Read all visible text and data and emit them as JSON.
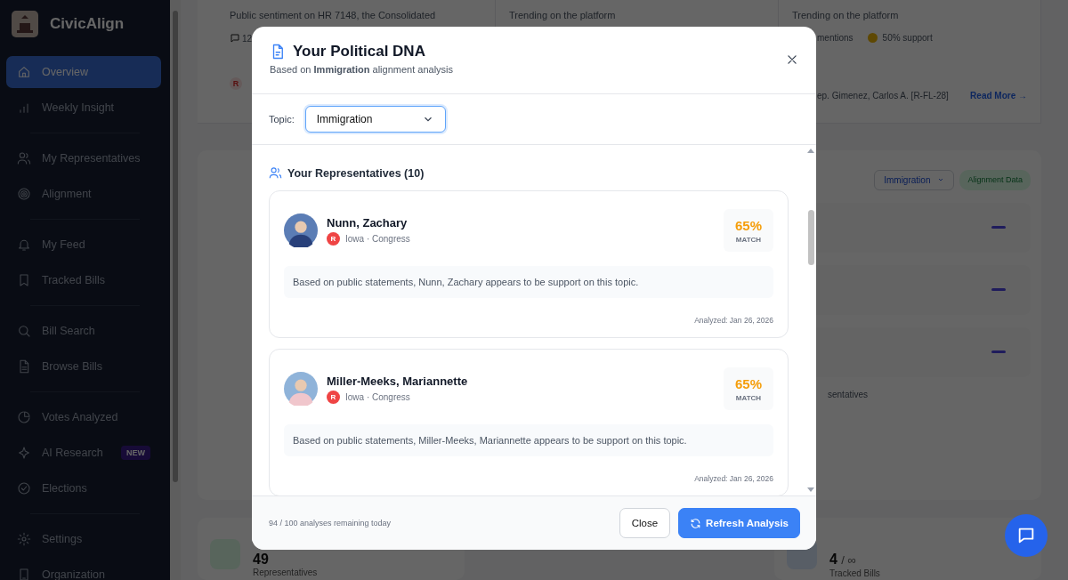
{
  "sidebar": {
    "brand": "CivicAlign",
    "groups": [
      {
        "items": [
          {
            "label": "Overview",
            "selected": true
          },
          {
            "label": "Weekly Insight",
            "selected": false
          }
        ]
      },
      {
        "items": [
          {
            "label": "My Representatives",
            "selected": false
          },
          {
            "label": "Alignment",
            "selected": false
          }
        ]
      },
      {
        "items": [
          {
            "label": "My Feed",
            "selected": false
          },
          {
            "label": "Tracked Bills",
            "selected": false
          }
        ]
      },
      {
        "items": [
          {
            "label": "Bill Search",
            "selected": false
          },
          {
            "label": "Browse Bills",
            "selected": false
          }
        ]
      },
      {
        "items": [
          {
            "label": "Votes Analyzed",
            "selected": false
          },
          {
            "label": "AI Research",
            "selected": false,
            "badge": "NEW"
          },
          {
            "label": "Elections",
            "selected": false
          }
        ]
      },
      {
        "items": [
          {
            "label": "Settings",
            "selected": false
          },
          {
            "label": "Organization",
            "selected": false
          }
        ]
      }
    ]
  },
  "background": {
    "cards": [
      {
        "text": "Public sentiment on HR 7148, the Consolidated",
        "count": "12",
        "party": "R"
      },
      {
        "text": "Trending on the platform"
      },
      {
        "text": "Trending on the platform",
        "mentions": "mentions",
        "support": "50% support",
        "sponsor": "ep. Gimenez, Carlos A. [R-FL-28]",
        "link": "Read More →"
      }
    ],
    "topic_select": "Immigration",
    "alignment_badge": "Alignment Data",
    "caption": "sentatives",
    "stats": [
      {
        "value": "49",
        "label": "Representatives"
      },
      {
        "value": "4",
        "suffix": "/ ∞",
        "label": "Tracked Bills"
      }
    ]
  },
  "modal": {
    "title": "Your Political DNA",
    "subtitle": "Based on **Immigration** alignment analysis",
    "topic_label": "Topic:",
    "topic_value": "Immigration",
    "section_title": "Your Representatives (10)",
    "representatives": [
      {
        "name": "Nunn, Zachary",
        "party": "R",
        "location": "Iowa · Congress",
        "match": "65%",
        "match_label": "MATCH",
        "statement": "Based on public statements, Nunn, Zachary appears to be support on this topic.",
        "analyzed": "Analyzed: Jan 26, 2026"
      },
      {
        "name": "Miller-Meeks, Mariannette",
        "party": "R",
        "location": "Iowa · Congress",
        "match": "65%",
        "match_label": "MATCH",
        "statement": "Based on public statements, Miller-Meeks, Mariannette appears to be support on this topic.",
        "analyzed": "Analyzed: Jan 26, 2026"
      }
    ],
    "footer_note": "94 / 100 analyses remaining today",
    "buttons": [
      "Close",
      "Refresh Analysis"
    ]
  }
}
